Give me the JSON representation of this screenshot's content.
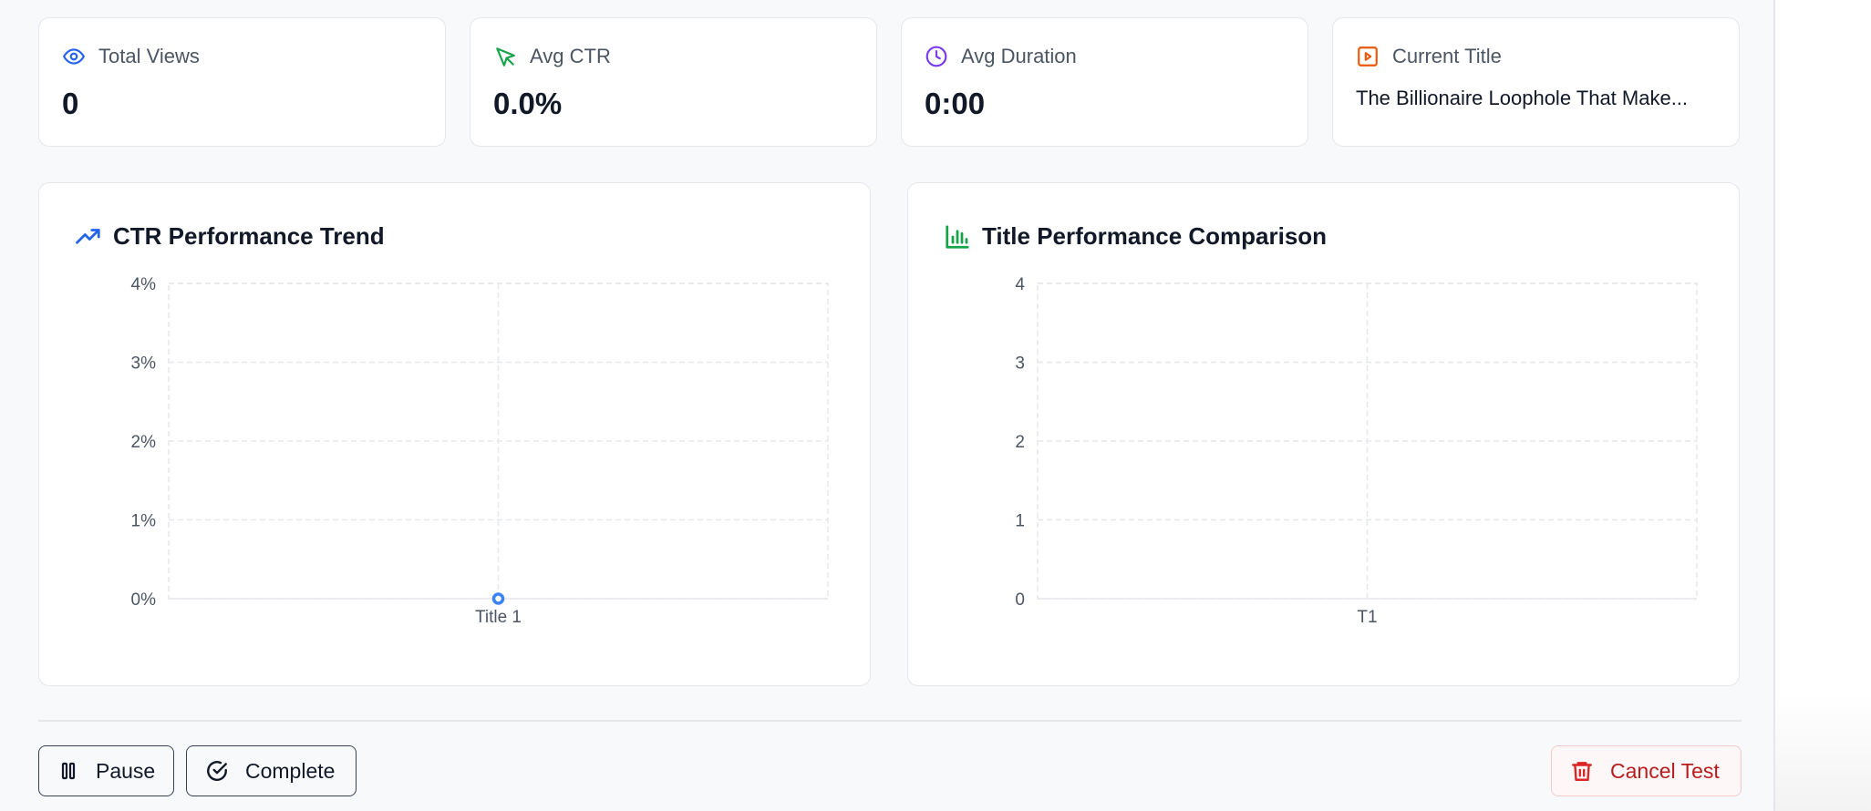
{
  "stats": {
    "total_views": {
      "label": "Total Views",
      "value": "0",
      "icon": "eye-icon",
      "color": "#2563eb"
    },
    "avg_ctr": {
      "label": "Avg CTR",
      "value": "0.0%",
      "icon": "cursor-arrow-icon",
      "color": "#16a34a"
    },
    "avg_duration": {
      "label": "Avg Duration",
      "value": "0:00",
      "icon": "clock-icon",
      "color": "#7c3aed"
    },
    "current_title": {
      "label": "Current Title",
      "value": "The Billionaire Loophole That Make...",
      "icon": "play-square-icon",
      "color": "#ea580c"
    }
  },
  "charts": {
    "ctr_trend": {
      "title": "CTR Performance Trend",
      "icon": "trending-up-icon",
      "color": "#2563eb"
    },
    "title_comparison": {
      "title": "Title Performance Comparison",
      "icon": "bar-chart-icon",
      "color": "#16a34a"
    }
  },
  "chart_data": [
    {
      "type": "line",
      "title": "CTR Performance Trend",
      "categories": [
        "Title 1"
      ],
      "series": [
        {
          "values": [
            0
          ]
        }
      ],
      "y_ticks": [
        "0%",
        "1%",
        "2%",
        "3%",
        "4%"
      ],
      "ylim": [
        0,
        4
      ],
      "grid": true,
      "point_color": "#3b82f6"
    },
    {
      "type": "bar",
      "title": "Title Performance Comparison",
      "categories": [
        "T1"
      ],
      "series": [
        {
          "values": [
            0
          ]
        }
      ],
      "y_ticks": [
        "0",
        "1",
        "2",
        "3",
        "4"
      ],
      "ylim": [
        0,
        4
      ],
      "grid": true
    }
  ],
  "actions": {
    "pause": {
      "label": "Pause",
      "icon": "pause-icon"
    },
    "complete": {
      "label": "Complete",
      "icon": "check-circle-icon"
    },
    "cancel": {
      "label": "Cancel Test",
      "icon": "trash-icon",
      "color": "#dc2626"
    }
  }
}
